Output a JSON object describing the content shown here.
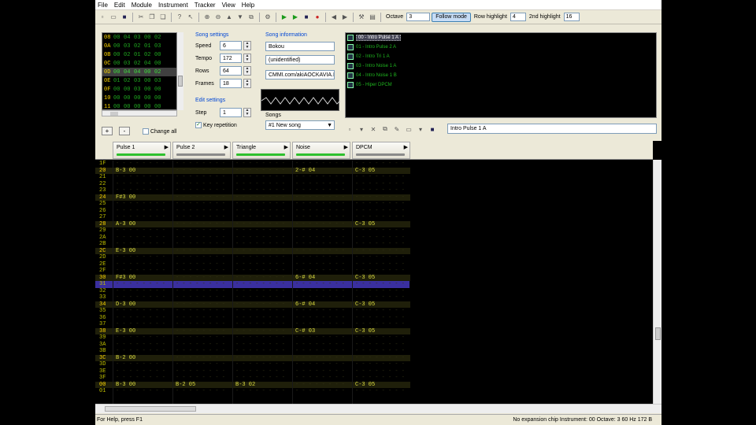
{
  "menu": [
    "File",
    "Edit",
    "Module",
    "Instrument",
    "Tracker",
    "View",
    "Help"
  ],
  "toolbar": {
    "octave_label": "Octave",
    "octave_value": "3",
    "follow_mode": "Follow mode",
    "row_highlight_label": "Row highlight",
    "row_highlight_value": "4",
    "second_highlight_label": "2nd highlight",
    "second_highlight_value": "16"
  },
  "frames": [
    {
      "num": "08",
      "vals": [
        "00",
        "04",
        "03",
        "00",
        "02"
      ]
    },
    {
      "num": "0A",
      "vals": [
        "00",
        "03",
        "02",
        "01",
        "03"
      ]
    },
    {
      "num": "0B",
      "vals": [
        "00",
        "02",
        "01",
        "02",
        "00"
      ]
    },
    {
      "num": "0C",
      "vals": [
        "00",
        "03",
        "02",
        "04",
        "00"
      ]
    },
    {
      "num": "0D",
      "vals": [
        "00",
        "04",
        "04",
        "00",
        "02"
      ]
    },
    {
      "num": "0E",
      "vals": [
        "01",
        "02",
        "03",
        "00",
        "03"
      ]
    },
    {
      "num": "0F",
      "vals": [
        "00",
        "00",
        "03",
        "00",
        "00"
      ]
    },
    {
      "num": "10",
      "vals": [
        "00",
        "00",
        "00",
        "00",
        "00"
      ]
    },
    {
      "num": "11",
      "vals": [
        "00",
        "00",
        "00",
        "00",
        "00"
      ]
    }
  ],
  "frame_controls": {
    "add": "+",
    "remove": "-",
    "change_all": "Change all"
  },
  "song_settings": {
    "title": "Song settings",
    "speed_label": "Speed",
    "speed": "6",
    "tempo_label": "Tempo",
    "tempo": "172",
    "rows_label": "Rows",
    "rows": "64",
    "frames_label": "Frames",
    "frames": "18"
  },
  "edit_settings": {
    "title": "Edit settings",
    "step_label": "Step",
    "step": "1",
    "key_repetition": "Key repetition"
  },
  "song_info": {
    "title": "Song information",
    "name": "Bokou",
    "artist": "(unidentified)",
    "copyright": "CMMI.com/akiAOCKAVIA.IT"
  },
  "songs": {
    "label": "Songs",
    "selected": "#1 New song"
  },
  "instruments": [
    {
      "label": "00 - Intro Pulse 1 A",
      "selected": true
    },
    {
      "label": "01 - Intro Pulse 2 A",
      "selected": false
    },
    {
      "label": "02 - Intro Tri 1 A",
      "selected": false
    },
    {
      "label": "03 - Intro Noise 1 A",
      "selected": false
    },
    {
      "label": "04 - Intro Noise 1 B",
      "selected": false
    },
    {
      "label": "05 - Hiper DPCM",
      "selected": false
    }
  ],
  "instrument_name": "Intro Pulse 1 A",
  "channels": [
    {
      "name": "Pulse 1",
      "vol_color": "#2ec02e"
    },
    {
      "name": "Pulse 2",
      "vol_color": "#8a8a8a"
    },
    {
      "name": "Triangle",
      "vol_color": "#2ec02e"
    },
    {
      "name": "Noise",
      "vol_color": "#2ec02e"
    },
    {
      "name": "DPCM",
      "vol_color": "#8a8a8a"
    }
  ],
  "pattern_rows": [
    {
      "num": "1F",
      "cells": [
        "",
        "",
        "",
        "",
        ""
      ],
      "hl": false
    },
    {
      "num": "20",
      "cells": [
        "B-3 00",
        "",
        "",
        "2-# 04",
        "C-3 05"
      ],
      "hl": true
    },
    {
      "num": "21",
      "cells": [
        "",
        "",
        "",
        "",
        ""
      ],
      "hl": false
    },
    {
      "num": "22",
      "cells": [
        "",
        "",
        "",
        "",
        ""
      ],
      "hl": false
    },
    {
      "num": "23",
      "cells": [
        "",
        "",
        "",
        "",
        ""
      ],
      "hl": false
    },
    {
      "num": "24",
      "cells": [
        "F#3 00",
        "",
        "",
        "",
        ""
      ],
      "hl": true
    },
    {
      "num": "25",
      "cells": [
        "",
        "",
        "",
        "",
        ""
      ],
      "hl": false
    },
    {
      "num": "26",
      "cells": [
        "",
        "",
        "",
        "",
        ""
      ],
      "hl": false
    },
    {
      "num": "27",
      "cells": [
        "",
        "",
        "",
        "",
        ""
      ],
      "hl": false
    },
    {
      "num": "28",
      "cells": [
        "A-3 00",
        "",
        "",
        "",
        "C-3 05"
      ],
      "hl": true
    },
    {
      "num": "29",
      "cells": [
        "",
        "",
        "",
        "",
        ""
      ],
      "hl": false
    },
    {
      "num": "2A",
      "cells": [
        "",
        "",
        "",
        "",
        ""
      ],
      "hl": false
    },
    {
      "num": "2B",
      "cells": [
        "",
        "",
        "",
        "",
        ""
      ],
      "hl": false
    },
    {
      "num": "2C",
      "cells": [
        "E-3 00",
        "",
        "",
        "",
        ""
      ],
      "hl": true
    },
    {
      "num": "2D",
      "cells": [
        "",
        "",
        "",
        "",
        ""
      ],
      "hl": false
    },
    {
      "num": "2E",
      "cells": [
        "",
        "",
        "",
        "",
        ""
      ],
      "hl": false
    },
    {
      "num": "2F",
      "cells": [
        "",
        "",
        "",
        "",
        ""
      ],
      "hl": false
    },
    {
      "num": "30",
      "cells": [
        "F#3 00",
        "",
        "",
        "6-# 04",
        "C-3 05"
      ],
      "hl": true
    },
    {
      "num": "31",
      "cells": [
        "",
        "",
        "",
        "",
        ""
      ],
      "hl": false,
      "cur": true
    },
    {
      "num": "32",
      "cells": [
        "",
        "",
        "",
        "",
        ""
      ],
      "hl": false
    },
    {
      "num": "33",
      "cells": [
        "",
        "",
        "",
        "",
        ""
      ],
      "hl": false
    },
    {
      "num": "34",
      "cells": [
        "D-3 00",
        "",
        "",
        "6-# 04",
        "C-3 05"
      ],
      "hl": true
    },
    {
      "num": "35",
      "cells": [
        "",
        "",
        "",
        "",
        ""
      ],
      "hl": false
    },
    {
      "num": "36",
      "cells": [
        "",
        "",
        "",
        "",
        ""
      ],
      "hl": false
    },
    {
      "num": "37",
      "cells": [
        "",
        "",
        "",
        "",
        ""
      ],
      "hl": false
    },
    {
      "num": "38",
      "cells": [
        "E-3 00",
        "",
        "",
        "C-# 03",
        "C-3 05"
      ],
      "hl": true
    },
    {
      "num": "39",
      "cells": [
        "",
        "",
        "",
        "",
        ""
      ],
      "hl": false
    },
    {
      "num": "3A",
      "cells": [
        "",
        "",
        "",
        "",
        ""
      ],
      "hl": false
    },
    {
      "num": "3B",
      "cells": [
        "",
        "",
        "",
        "",
        ""
      ],
      "hl": false
    },
    {
      "num": "3C",
      "cells": [
        "B-2 00",
        "",
        "",
        "",
        ""
      ],
      "hl": true
    },
    {
      "num": "3D",
      "cells": [
        "",
        "",
        "",
        "",
        ""
      ],
      "hl": false
    },
    {
      "num": "3E",
      "cells": [
        "",
        "",
        "",
        "",
        ""
      ],
      "hl": false
    },
    {
      "num": "3F",
      "cells": [
        "",
        "",
        "",
        "",
        ""
      ],
      "hl": false
    },
    {
      "num": "00",
      "cells": [
        "B-3 00",
        "B-2 05",
        "B-3 02",
        "",
        "C-3 05"
      ],
      "hl": true
    },
    {
      "num": "01",
      "cells": [
        "",
        "",
        "",
        "",
        ""
      ],
      "hl": false
    }
  ],
  "status": {
    "help": "For Help, press F1",
    "info": "No expansion chip   Instrument: 00   Octave: 3   60 Hz   172 B"
  }
}
